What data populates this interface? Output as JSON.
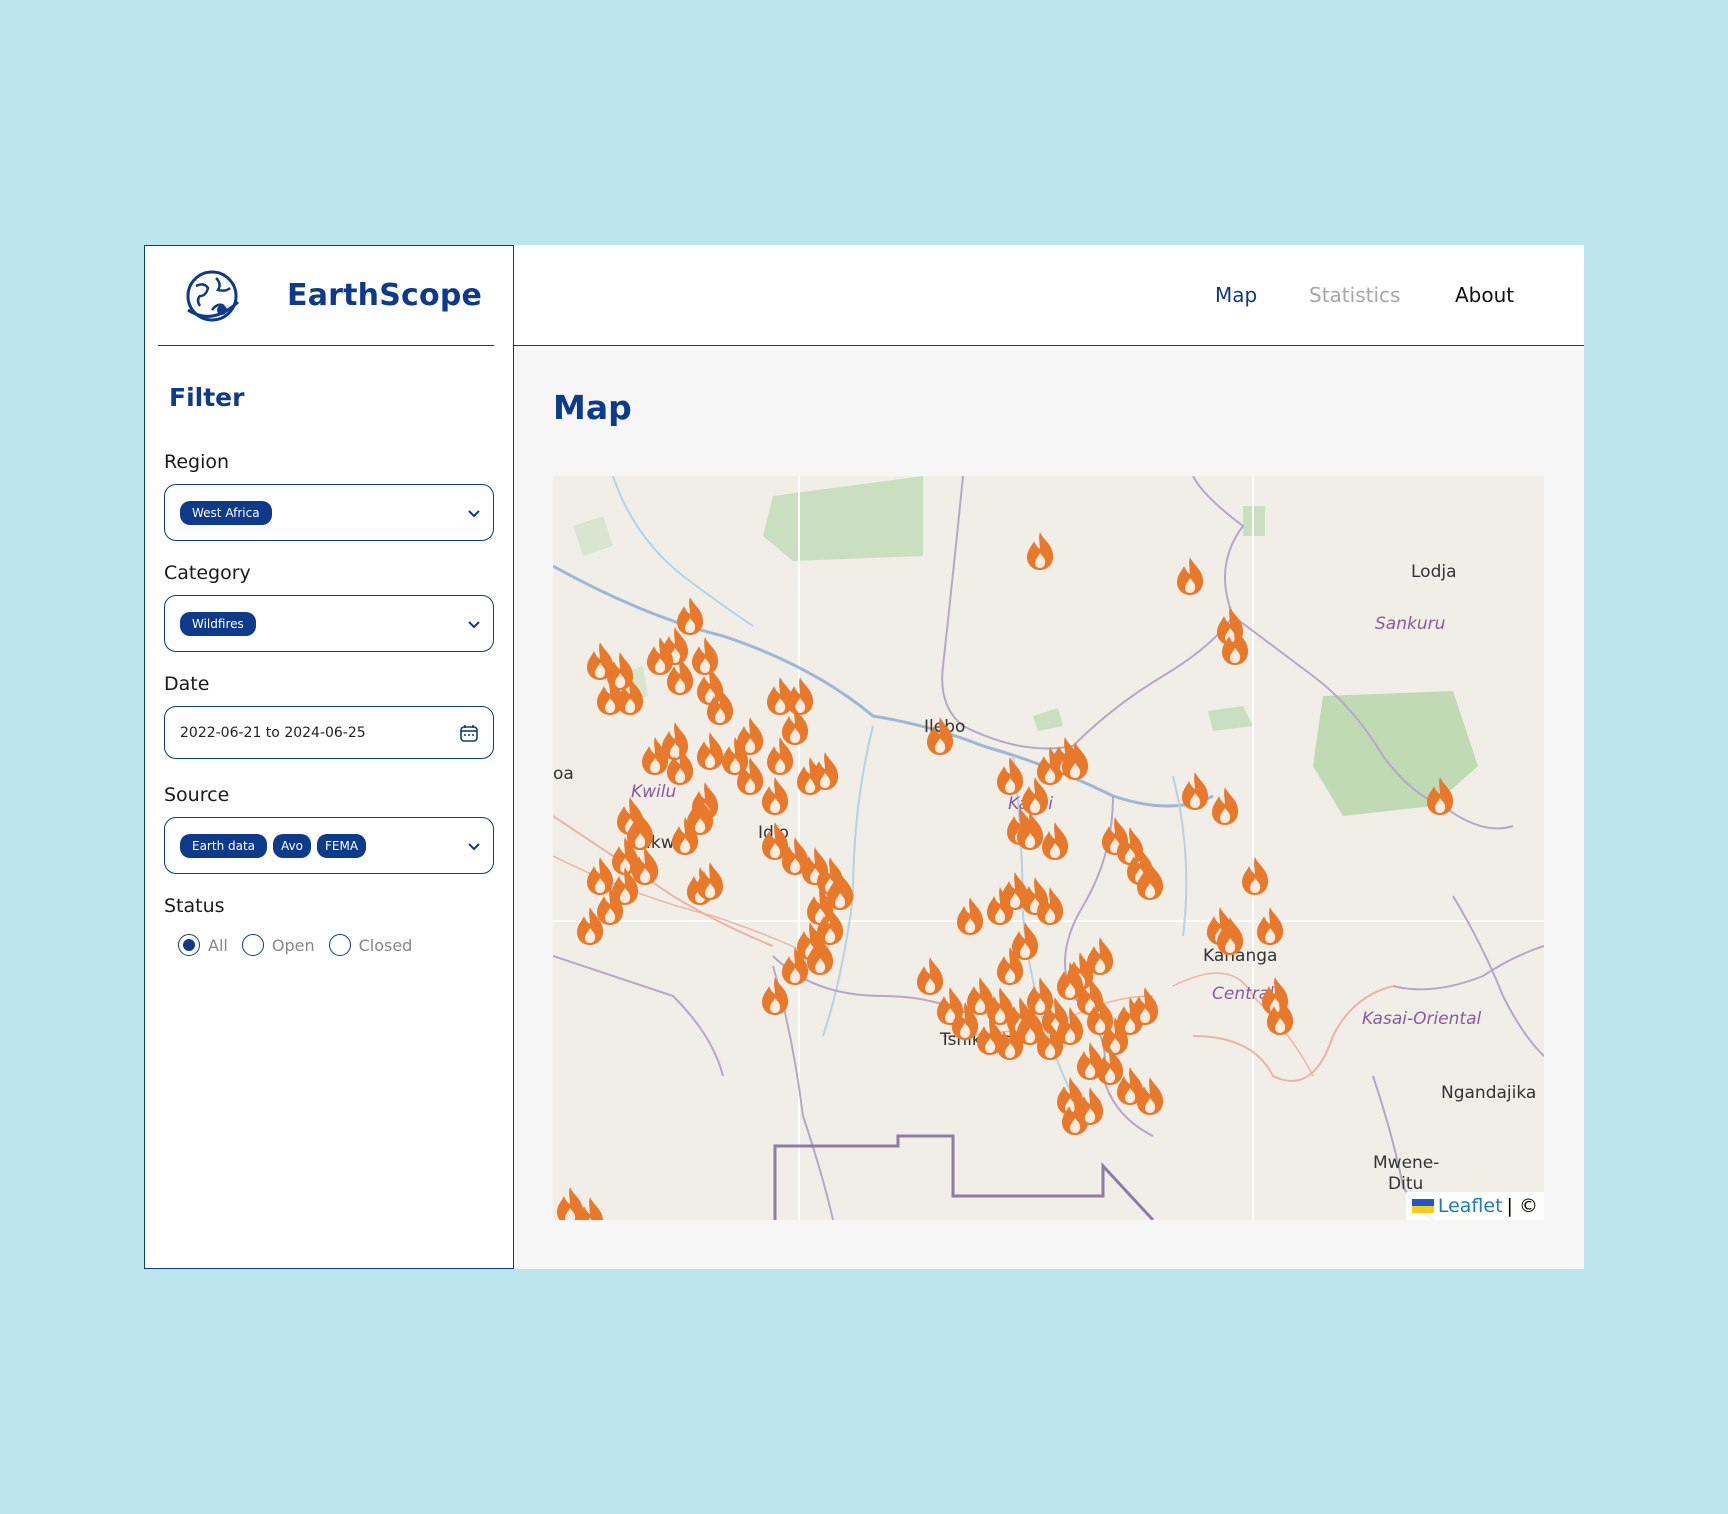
{
  "brand": {
    "name": "EarthScope",
    "logo_icon": "globe-icon"
  },
  "sidebar": {
    "filter_title": "Filter",
    "region": {
      "label": "Region",
      "chips": [
        "West Africa"
      ]
    },
    "category": {
      "label": "Category",
      "chips": [
        "Wildfires"
      ]
    },
    "date": {
      "label": "Date",
      "value": "2022-06-21 to 2024-06-25",
      "icon": "calendar-icon"
    },
    "source": {
      "label": "Source",
      "chips": [
        "Earth data",
        "Avo",
        "FEMA"
      ]
    },
    "status": {
      "label": "Status",
      "options": [
        "All",
        "Open",
        "Closed"
      ],
      "selected": "All"
    }
  },
  "nav": {
    "map": "Map",
    "statistics": "Statistics",
    "about": "About"
  },
  "page": {
    "title": "Map"
  },
  "map": {
    "place_labels": [
      "Lodja",
      "Sankuru",
      "Ilebo",
      "Kwilu",
      "Idio",
      "Kikwit",
      "Kasai",
      "Kananga",
      "Central",
      "Kasai-Oriental",
      "Tshikapa",
      "Ngandajika",
      "Mwene-",
      "Ditu",
      "oa"
    ],
    "attribution": {
      "leaflet": "Leaflet",
      "rest": "| ©"
    },
    "marker_icon": "fire-icon",
    "colors": {
      "marker": "#e8782a",
      "brand": "#0e3a8c",
      "background": "#bce5ed"
    }
  }
}
